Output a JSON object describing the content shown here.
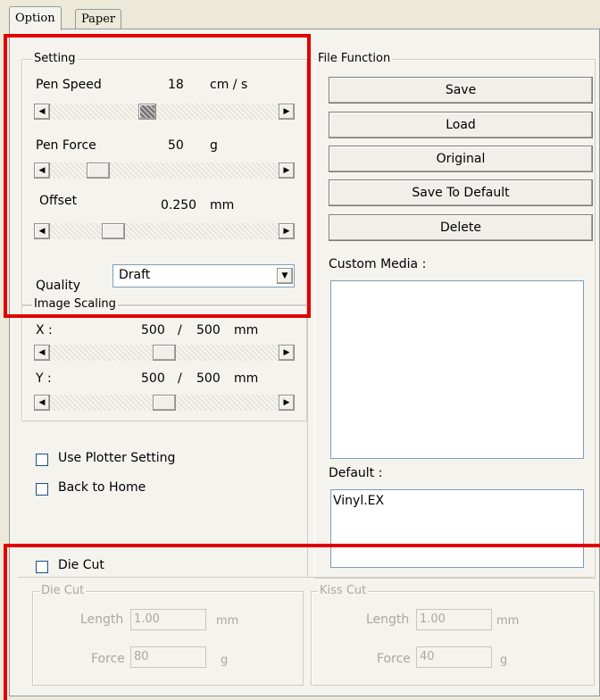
{
  "tabs": [
    {
      "label": "Option"
    },
    {
      "label": "Paper"
    }
  ],
  "setting": {
    "legend": "Setting",
    "pen_speed": {
      "label": "Pen Speed",
      "value": "18",
      "unit": "cm / s",
      "level": 0.42
    },
    "pen_force": {
      "label": "Pen Force",
      "value": "50",
      "unit": "g",
      "level": 0.18
    },
    "offset": {
      "label": "Offset",
      "value": "0.250",
      "unit": "mm",
      "level": 0.25
    },
    "quality": {
      "label": "Quality",
      "value": "Draft"
    }
  },
  "image_scaling": {
    "legend": "Image Scaling",
    "x": {
      "label": "X :",
      "value": "500",
      "separator": "/",
      "max": "500",
      "unit": "mm",
      "level": 0.5
    },
    "y": {
      "label": "Y :",
      "value": "500",
      "separator": "/",
      "max": "500",
      "unit": "mm",
      "level": 0.5
    }
  },
  "options": {
    "use_plotter": "Use Plotter Setting",
    "back_home": "Back to Home",
    "die_cut": "Die Cut"
  },
  "file_function": {
    "legend": "File Function",
    "buttons": [
      "Save",
      "Load",
      "Original",
      "Save To Default",
      "Delete"
    ],
    "custom_media_label": "Custom Media :",
    "default_label": "Default :",
    "default_items": [
      "Vinyl.EX"
    ]
  },
  "die_cut_group": {
    "legend": "Die Cut",
    "length_label": "Length",
    "length": "1.00",
    "length_unit": "mm",
    "force_label": "Force",
    "force": "80",
    "force_unit": "g"
  },
  "kiss_cut_group": {
    "legend": "Kiss Cut",
    "length_label": "Length",
    "length": "1.00",
    "length_unit": "mm",
    "force_label": "Force",
    "force": "40",
    "force_unit": "g"
  }
}
